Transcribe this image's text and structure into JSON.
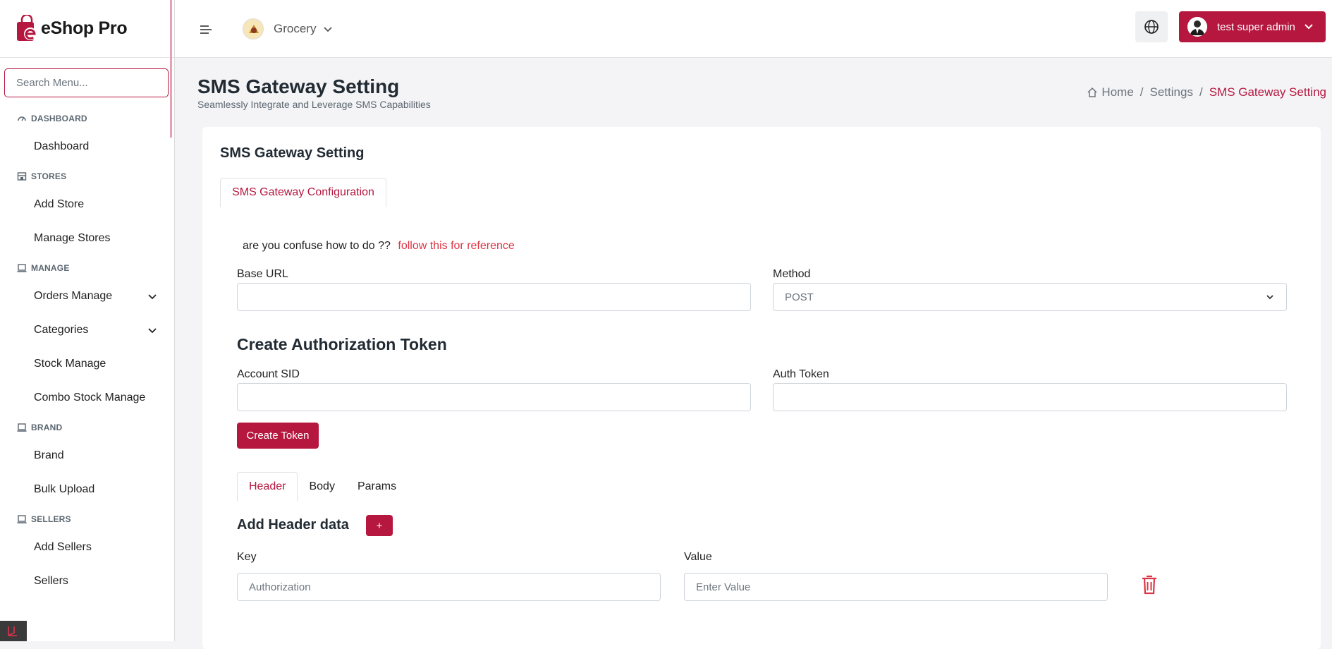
{
  "app": {
    "name": "eShop Pro"
  },
  "sidebar": {
    "search_placeholder": "Search Menu...",
    "sections": {
      "dashboard": {
        "title": "DASHBOARD",
        "items": [
          "Dashboard"
        ]
      },
      "stores": {
        "title": "STORES",
        "items": [
          "Add Store",
          "Manage Stores"
        ]
      },
      "manage": {
        "title": "MANAGE",
        "items": [
          "Orders Manage",
          "Categories",
          "Stock Manage",
          "Combo Stock Manage"
        ]
      },
      "brand": {
        "title": "BRAND",
        "items": [
          "Brand",
          "Bulk Upload"
        ]
      },
      "sellers": {
        "title": "SELLERS",
        "items": [
          "Add Sellers",
          "Sellers"
        ]
      }
    }
  },
  "topbar": {
    "store_name": "Grocery",
    "user_name": "test super admin"
  },
  "page": {
    "title": "SMS Gateway Setting",
    "subtitle": "Seamlessly Integrate and Leverage SMS Capabilities",
    "breadcrumb": [
      "Home",
      "Settings",
      "SMS Gateway Setting"
    ]
  },
  "card": {
    "title": "SMS Gateway Setting",
    "tab": "SMS Gateway Configuration",
    "ref_text": "are you confuse how to do ??",
    "ref_link": "follow this for reference",
    "base_url_label": "Base URL",
    "base_url_value": "",
    "method_label": "Method",
    "method_value": "POST",
    "auth_heading": "Create Authorization Token",
    "account_sid_label": "Account SID",
    "account_sid_value": "",
    "auth_token_label": "Auth Token",
    "auth_token_value": "",
    "create_token_label": "Create Token",
    "subtabs": [
      "Header",
      "Body",
      "Params"
    ],
    "header_heading": "Add Header data",
    "add_button": "+",
    "key_label": "Key",
    "key_placeholder": "Authorization",
    "value_label": "Value",
    "value_placeholder": "Enter Value"
  },
  "colors": {
    "accent": "#b5173f",
    "link_red": "#dc3545"
  }
}
